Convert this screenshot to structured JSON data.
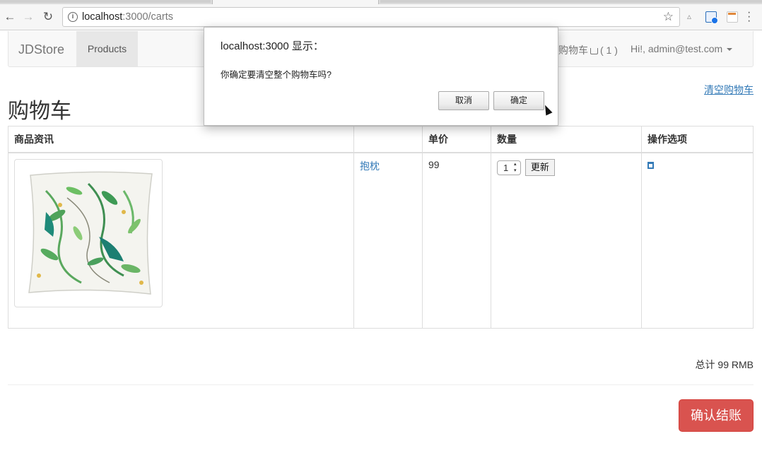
{
  "browser": {
    "url_host": "localhost",
    "url_path": ":3000/carts"
  },
  "navbar": {
    "brand": "JDStore",
    "products": "Products",
    "cart_label": "购物车",
    "cart_count": "( 1 )",
    "user": "Hi!, admin@test.com"
  },
  "page": {
    "clear_cart": "清空购物车",
    "title": "购物车",
    "total": "总计 99 RMB",
    "checkout": "确认结账"
  },
  "table": {
    "headers": [
      "商品资讯",
      "",
      "单价",
      "数量",
      "操作选项"
    ],
    "rows": [
      {
        "name": "抱枕",
        "price": "99",
        "qty": "1",
        "update": "更新"
      }
    ]
  },
  "dialog": {
    "title": "localhost:3000 显示：",
    "message": "你确定要清空整个购物车吗?",
    "cancel": "取消",
    "ok": "确定"
  },
  "icons": {
    "back": "arrow-left-icon",
    "forward": "arrow-right-icon",
    "reload": "reload-icon",
    "info": "info-icon",
    "bookmark": "star-icon",
    "cart": "shopping-cart-icon",
    "trash": "trash-icon"
  }
}
